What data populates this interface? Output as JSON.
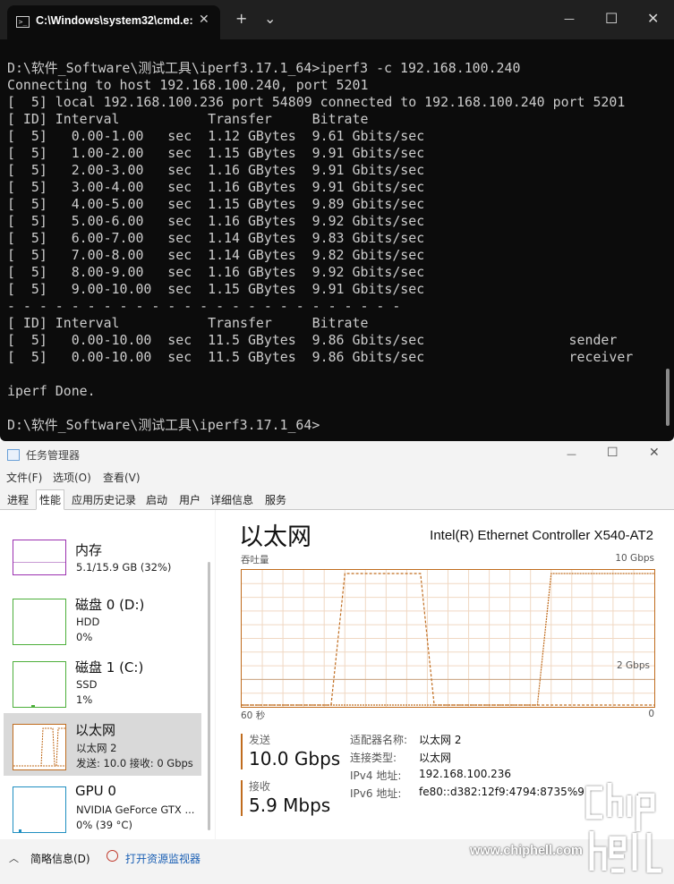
{
  "terminal": {
    "tab_title": "C:\\Windows\\system32\\cmd.e:",
    "tab_close": "✕",
    "new_tab": "+",
    "dropdown": "⌄",
    "minimize": "—",
    "maximize": "☐",
    "close": "✕",
    "lines": [
      "D:\\软件_Software\\测试工具\\iperf3.17.1_64>iperf3 -c 192.168.100.240",
      "Connecting to host 192.168.100.240, port 5201",
      "[  5] local 192.168.100.236 port 54809 connected to 192.168.100.240 port 5201",
      "[ ID] Interval           Transfer     Bitrate",
      "[  5]   0.00-1.00   sec  1.12 GBytes  9.61 Gbits/sec",
      "[  5]   1.00-2.00   sec  1.15 GBytes  9.91 Gbits/sec",
      "[  5]   2.00-3.00   sec  1.16 GBytes  9.91 Gbits/sec",
      "[  5]   3.00-4.00   sec  1.16 GBytes  9.91 Gbits/sec",
      "[  5]   4.00-5.00   sec  1.15 GBytes  9.89 Gbits/sec",
      "[  5]   5.00-6.00   sec  1.16 GBytes  9.92 Gbits/sec",
      "[  5]   6.00-7.00   sec  1.14 GBytes  9.83 Gbits/sec",
      "[  5]   7.00-8.00   sec  1.14 GBytes  9.82 Gbits/sec",
      "[  5]   8.00-9.00   sec  1.16 GBytes  9.92 Gbits/sec",
      "[  5]   9.00-10.00  sec  1.15 GBytes  9.91 Gbits/sec",
      "- - - - - - - - - - - - - - - - - - - - - - - - -",
      "[ ID] Interval           Transfer     Bitrate",
      "[  5]   0.00-10.00  sec  11.5 GBytes  9.86 Gbits/sec                  sender",
      "[  5]   0.00-10.00  sec  11.5 GBytes  9.86 Gbits/sec                  receiver",
      "",
      "iperf Done.",
      "",
      "D:\\软件_Software\\测试工具\\iperf3.17.1_64>"
    ]
  },
  "taskmgr": {
    "title": "任务管理器",
    "minimize": "—",
    "maximize": "☐",
    "close": "✕",
    "menu": [
      "文件(F)",
      "选项(O)",
      "查看(V)"
    ],
    "tabs": [
      "进程",
      "性能",
      "应用历史记录",
      "启动",
      "用户",
      "详细信息",
      "服务"
    ],
    "active_tab": "性能",
    "sidebar": [
      {
        "name": "内存",
        "line1": "5.1/15.9 GB (32%)",
        "line2": "",
        "color": "#9b30b0"
      },
      {
        "name": "磁盘 0 (D:)",
        "line1": "HDD",
        "line2": "0%",
        "color": "#4caf3a"
      },
      {
        "name": "磁盘 1 (C:)",
        "line1": "SSD",
        "line2": "1%",
        "color": "#4caf3a"
      },
      {
        "name": "以太网",
        "line1": "以太网 2",
        "line2": "发送: 10.0 接收: 0 Gbps",
        "color": "#c06c1e",
        "selected": true
      },
      {
        "name": "GPU 0",
        "line1": "NVIDIA GeForce GTX ...",
        "line2": "0% (39 °C)",
        "color": "#1f8fc1"
      }
    ],
    "ethernet": {
      "title": "以太网",
      "adapter": "Intel(R) Ethernet Controller X540-AT2",
      "graph_label": "吞吐量",
      "graph_max": "10 Gbps",
      "graph_mark": "2 Gbps",
      "x_left": "60 秒",
      "x_right": "0",
      "send_label": "发送",
      "send_value": "10.0 Gbps",
      "recv_label": "接收",
      "recv_value": "5.9 Mbps",
      "info": [
        {
          "key": "适配器名称:",
          "value": "以太网 2"
        },
        {
          "key": "连接类型:",
          "value": "以太网"
        },
        {
          "key": "IPv4 地址:",
          "value": "192.168.100.236"
        },
        {
          "key": "IPv6 地址:",
          "value": "fe80::d382:12f9:4794:8735%9"
        }
      ],
      "series_color": "#c06c1e"
    },
    "footer": {
      "chevron": "︿",
      "summary": "简略信息(D)",
      "resource_monitor": "打开资源监视器"
    }
  },
  "watermark": {
    "url": "www.chiphell.com",
    "logo_text": "chip hell"
  },
  "chart_data": {
    "type": "line",
    "title": "吞吐量",
    "xlabel": "",
    "ylabel": "",
    "x_range_labels": [
      "60 秒",
      "0"
    ],
    "ylim": [
      0,
      10
    ],
    "y_unit": "Gbps",
    "annotations": [
      "10 Gbps",
      "2 Gbps"
    ],
    "grid": true,
    "series": [
      {
        "x": [
          60,
          48,
          47,
          46,
          45,
          38,
          37,
          36,
          34,
          33,
          32,
          31,
          30,
          29,
          28,
          27,
          26,
          25,
          24,
          23,
          22,
          21,
          20,
          19,
          18,
          17,
          16,
          15,
          14,
          13,
          12,
          11,
          10,
          9,
          8,
          7,
          6,
          5,
          4,
          3,
          2,
          1,
          0
        ],
        "y": [
          0,
          0,
          0,
          5,
          10,
          10,
          10,
          10,
          10,
          5,
          0,
          0,
          0,
          0,
          0,
          0,
          0,
          0,
          0,
          0,
          0,
          0,
          0,
          0,
          0,
          0,
          0,
          0,
          0,
          0,
          0,
          0,
          0,
          0,
          0,
          0,
          0,
          0,
          0,
          0,
          0,
          0,
          0
        ]
      },
      {
        "x": [
          60,
          18,
          17,
          16,
          15,
          14,
          12,
          10,
          8,
          6,
          4,
          2,
          0
        ],
        "y": [
          0,
          0,
          0,
          5,
          10,
          10,
          10,
          10,
          10,
          10,
          10,
          10,
          10
        ]
      }
    ]
  }
}
